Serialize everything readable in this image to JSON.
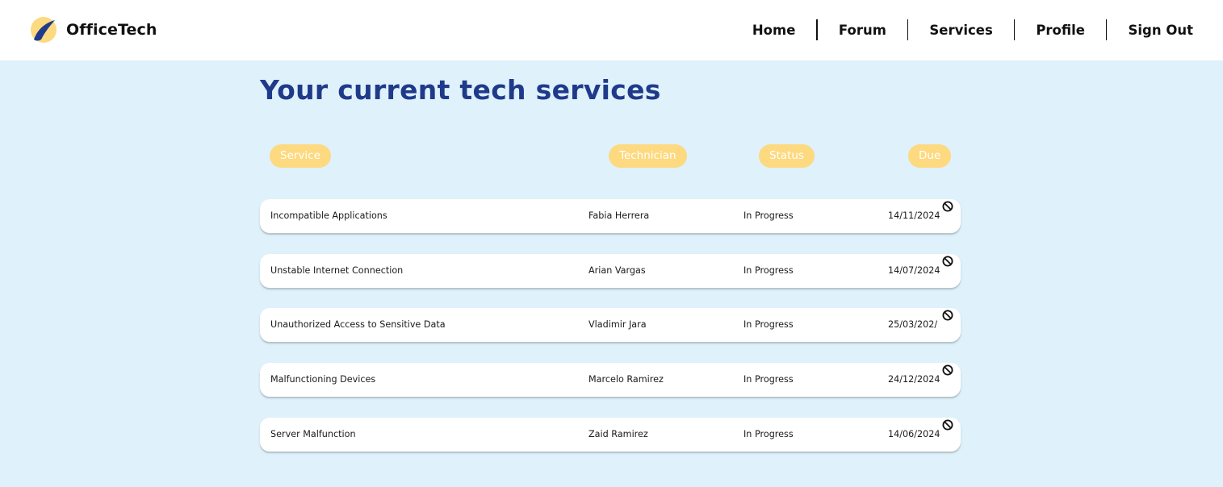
{
  "app": {
    "brand": "OfficeTech",
    "logo_icon": "crescent-swoosh-logo",
    "colors": {
      "background": "#dff1fb",
      "title": "#1f3a8a",
      "header_pill": "#fdd97f",
      "logo_blue": "#1f3a8a",
      "logo_yellow": "#fdd97f"
    }
  },
  "nav": {
    "items": [
      {
        "label": "Home"
      },
      {
        "label": "Forum"
      },
      {
        "label": "Services"
      },
      {
        "label": "Profile"
      },
      {
        "label": "Sign Out"
      }
    ]
  },
  "main": {
    "title": "Your current tech services",
    "columns": {
      "service": "Service",
      "technician": "Technician",
      "status": "Status",
      "due": "Due"
    },
    "rows": [
      {
        "service": "Incompatible Applications",
        "technician": "Fabia Herrera",
        "status": "In Progress",
        "due": "14/11/2024",
        "action_icon": "cancel-icon"
      },
      {
        "service": "Unstable Internet Connection",
        "technician": "Arian Vargas",
        "status": "In Progress",
        "due": "14/07/2024",
        "action_icon": "cancel-icon"
      },
      {
        "service": "Unauthorized Access to Sensitive Data",
        "technician": "Vladimir Jara",
        "status": "In Progress",
        "due": "25/03/202/",
        "action_icon": "cancel-icon"
      },
      {
        "service": "Malfunctioning Devices",
        "technician": "Marcelo Ramirez",
        "status": "In Progress",
        "due": "24/12/2024",
        "action_icon": "cancel-icon"
      },
      {
        "service": "Server Malfunction",
        "technician": "Zaid Ramirez",
        "status": "In Progress",
        "due": "14/06/2024",
        "action_icon": "cancel-icon"
      }
    ]
  }
}
